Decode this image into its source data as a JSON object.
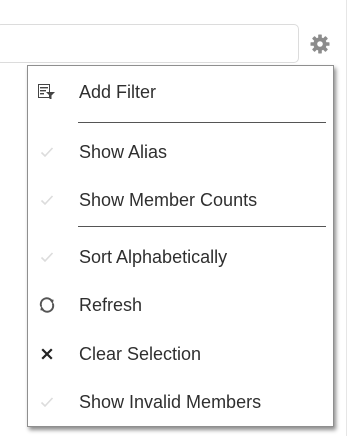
{
  "toolbar": {
    "gear_icon": "gear-icon"
  },
  "menu": {
    "items": [
      {
        "label": "Add Filter",
        "icon": "add-filter-icon"
      },
      {
        "label": "Show Alias",
        "icon": "check-icon"
      },
      {
        "label": "Show Member Counts",
        "icon": "check-icon"
      },
      {
        "label": "Sort Alphabetically",
        "icon": "check-icon"
      },
      {
        "label": "Refresh",
        "icon": "refresh-icon"
      },
      {
        "label": "Clear Selection",
        "icon": "close-icon"
      },
      {
        "label": "Show Invalid Members",
        "icon": "check-icon"
      }
    ]
  },
  "colors": {
    "menu_text": "#2f2f2f",
    "check_disabled": "#dcdcdc",
    "gear": "#8c8c8c",
    "separator": "#555555"
  }
}
